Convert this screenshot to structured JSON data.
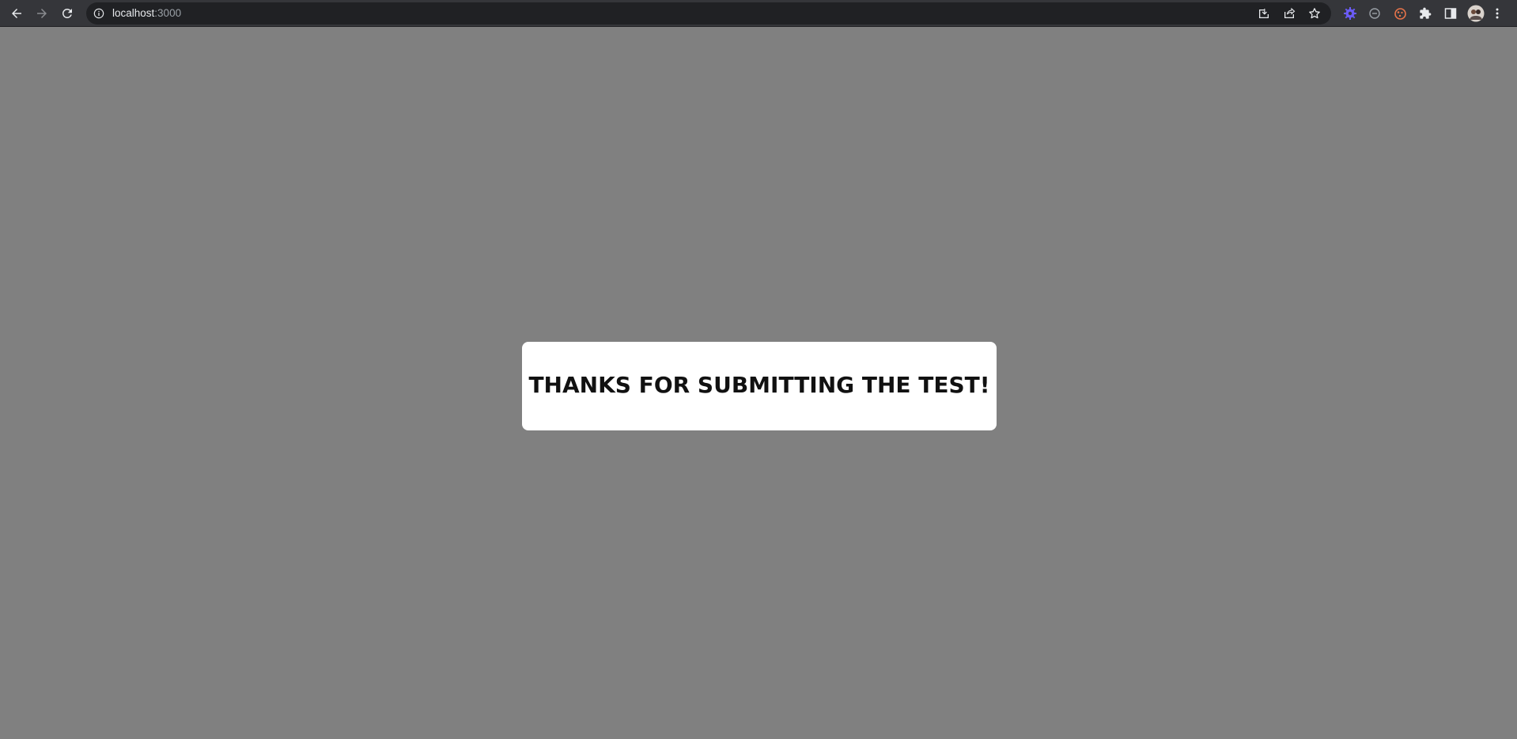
{
  "browser": {
    "url_host": "localhost",
    "url_port": ":3000",
    "icons": {
      "back": "back-arrow-icon",
      "forward": "forward-arrow-icon",
      "reload": "reload-icon",
      "site_info": "info-icon",
      "install": "install-app-icon",
      "share": "share-icon",
      "bookmark": "star-icon",
      "extension_1": "purple-gear-extension-icon",
      "extension_2": "circle-extension-icon",
      "extension_3": "cookie-extension-icon",
      "extensions_menu": "puzzle-icon",
      "side_panel": "side-panel-icon",
      "profile": "avatar",
      "menu": "kebab-menu-icon"
    },
    "colors": {
      "toolbar": "#35363a",
      "omnibox": "#202124",
      "icon": "#e8eaed",
      "extension_purple": "#6b5cf6",
      "extension_orange": "#e8744a"
    }
  },
  "page": {
    "background": "#808080",
    "message": "THANKS FOR SUBMITTING THE TEST!"
  }
}
